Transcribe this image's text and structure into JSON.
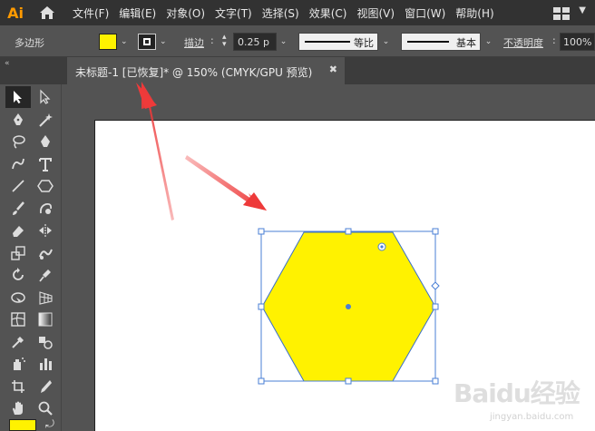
{
  "app": {
    "logo": "Ai"
  },
  "menu": [
    "文件(F)",
    "编辑(E)",
    "对象(O)",
    "文字(T)",
    "选择(S)",
    "效果(C)",
    "视图(V)",
    "窗口(W)",
    "帮助(H)"
  ],
  "control": {
    "object_type": "多边形",
    "stroke_label": "描边",
    "stroke_weight": "0.25 p",
    "stroke_profile": "等比",
    "brush": "基本",
    "opacity_label": "不透明度",
    "opacity_value": "100%"
  },
  "tab": {
    "title": "未标题-1 [已恢复]* @ 150% (CMYK/GPU 预览)",
    "close": "✖"
  },
  "colors": {
    "fill": "#fff200",
    "selection": "#4a7fd6",
    "arrow": "#ee3a3a"
  },
  "watermark": {
    "main": "Baidu经验",
    "sub": "jingyan.baidu.com"
  }
}
